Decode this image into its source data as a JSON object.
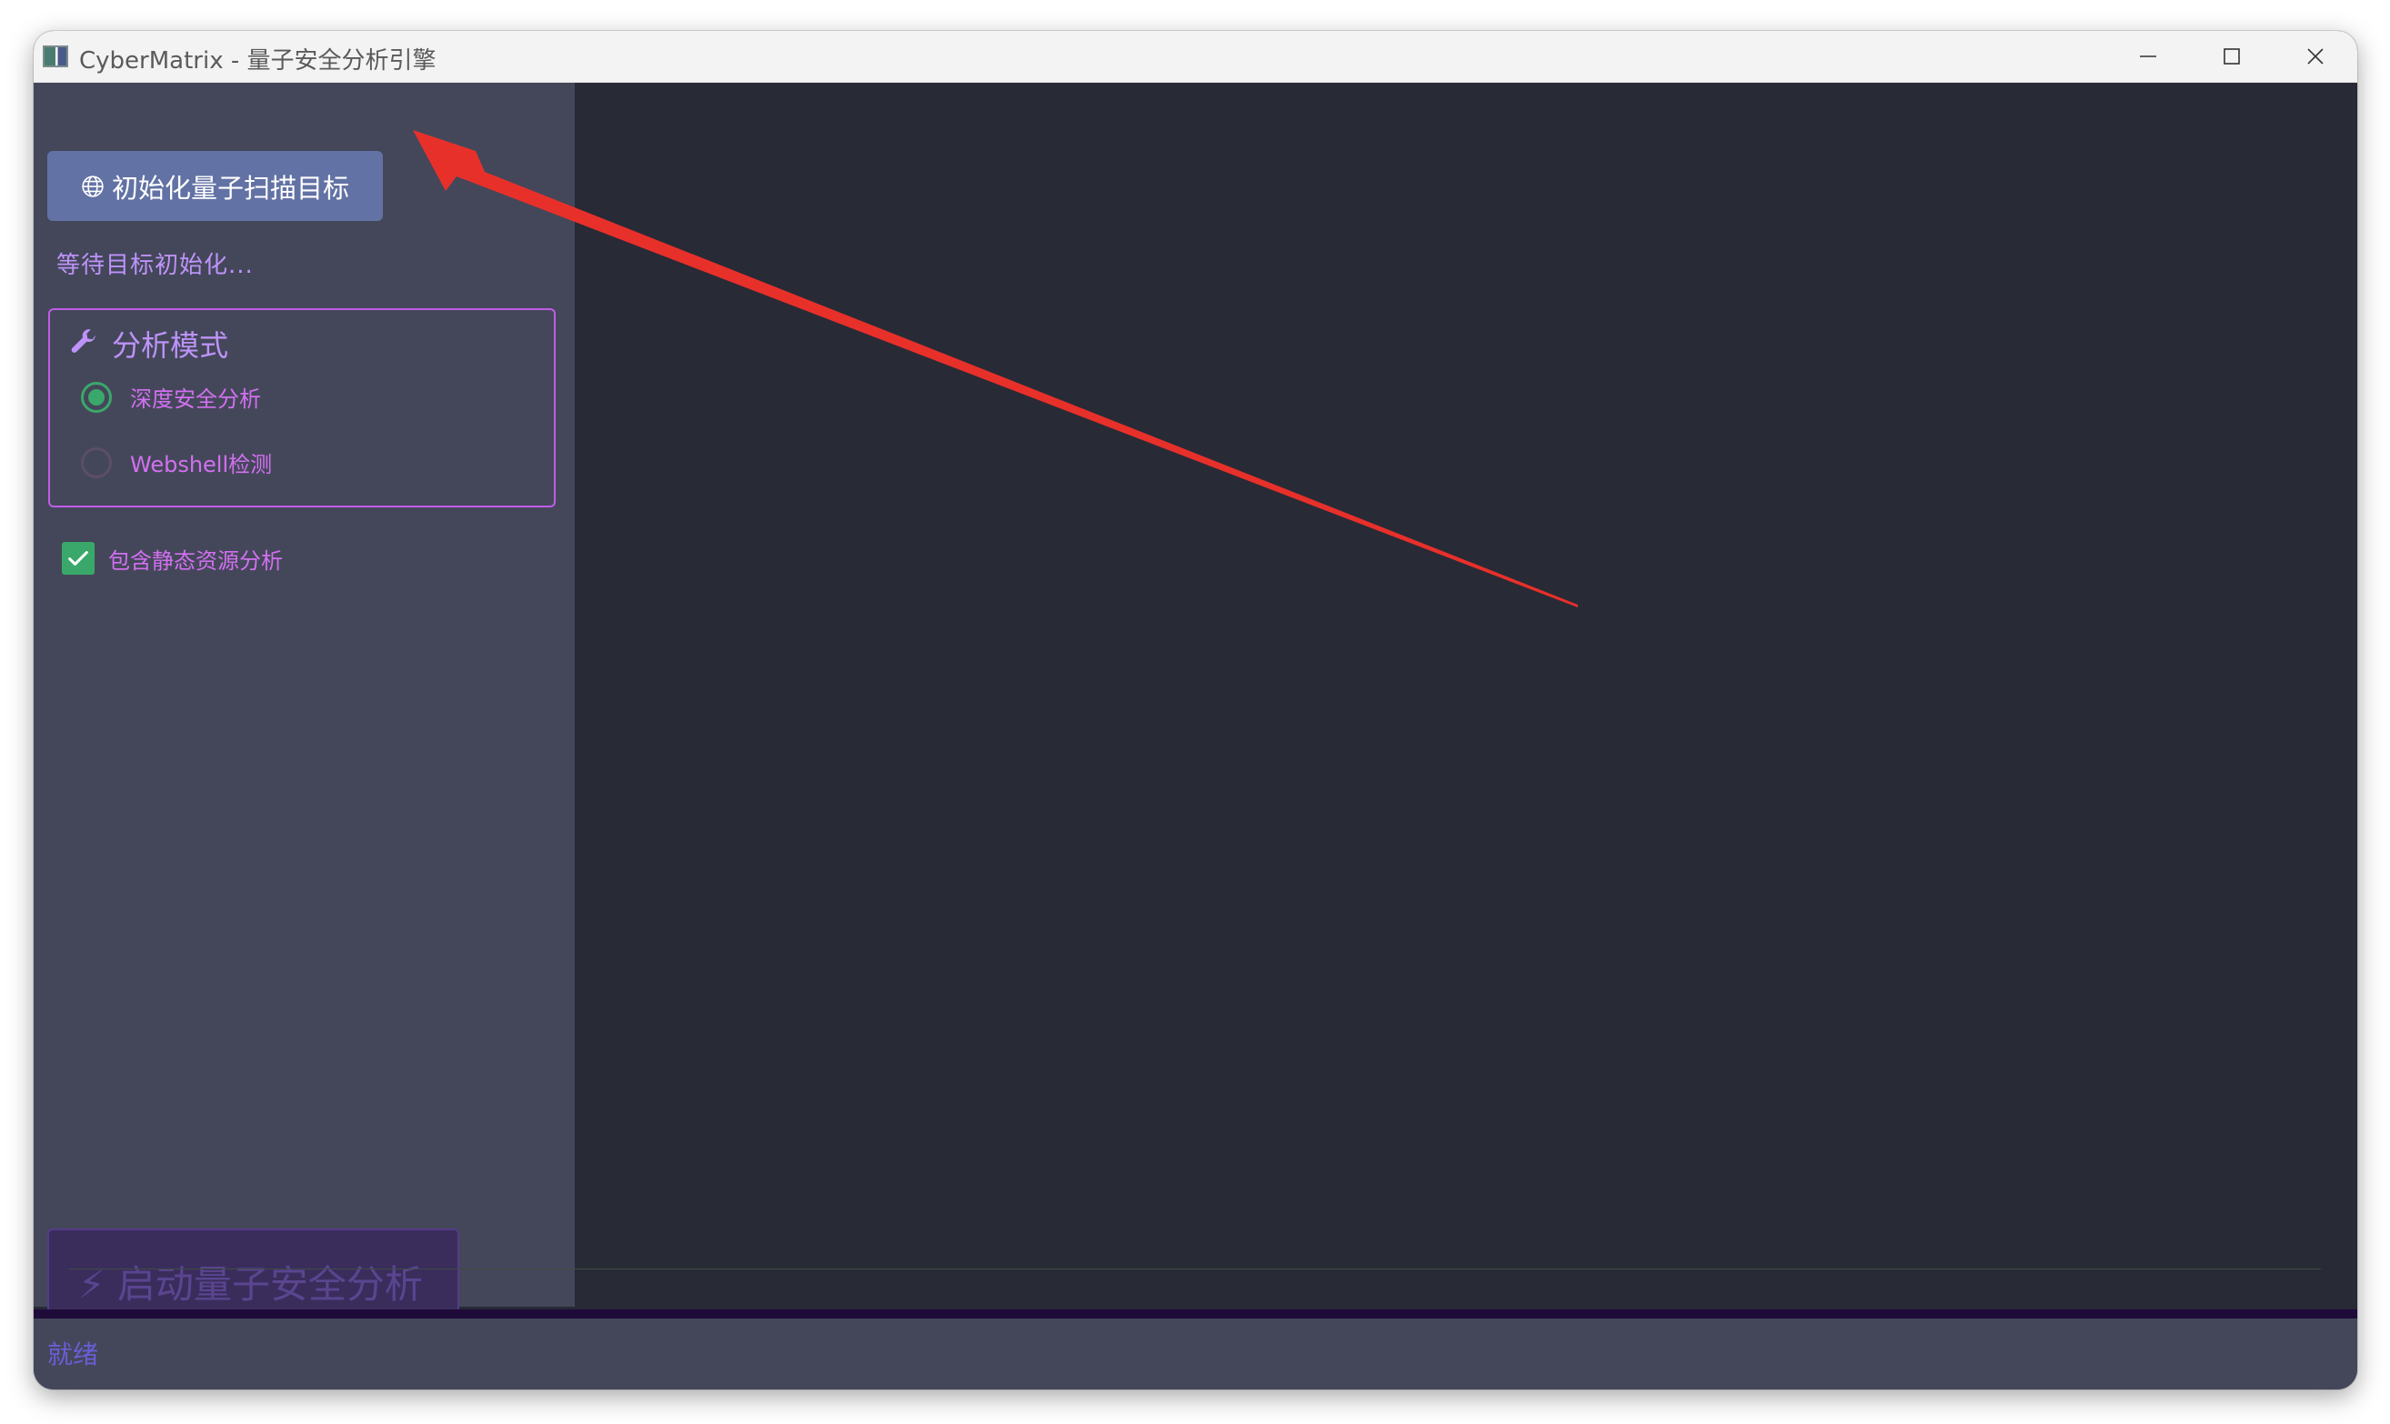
{
  "window": {
    "title": "CyberMatrix - 量子安全分析引擎"
  },
  "sidebar": {
    "init_button_label": "初始化量子扫描目标",
    "wait_status": "等待目标初始化...",
    "analysis_mode": {
      "title": "分析模式",
      "options": [
        {
          "label": "深度安全分析",
          "checked": true
        },
        {
          "label": "Webshell检测",
          "checked": false
        }
      ]
    },
    "include_static": {
      "label": "包含静态资源分析",
      "checked": true
    },
    "start_button_label": "⚡ 启动量子安全分析"
  },
  "statusbar": {
    "text": "就绪"
  },
  "icons": {
    "app": "app-icon",
    "minimize": "minimize-icon",
    "maximize": "maximize-icon",
    "close": "close-icon",
    "globe": "globe-icon",
    "wrench": "wrench-icon",
    "check": "check-icon",
    "bolt": "lightning-bolt-icon"
  },
  "colors": {
    "sidebar_bg": "#44475a",
    "content_bg": "#282a36",
    "accent_button": "#6272a4",
    "purple_text": "#bd93f9",
    "magenta_text": "#d270f0",
    "green": "#3aa86a",
    "annotation_red": "#e8302a"
  }
}
